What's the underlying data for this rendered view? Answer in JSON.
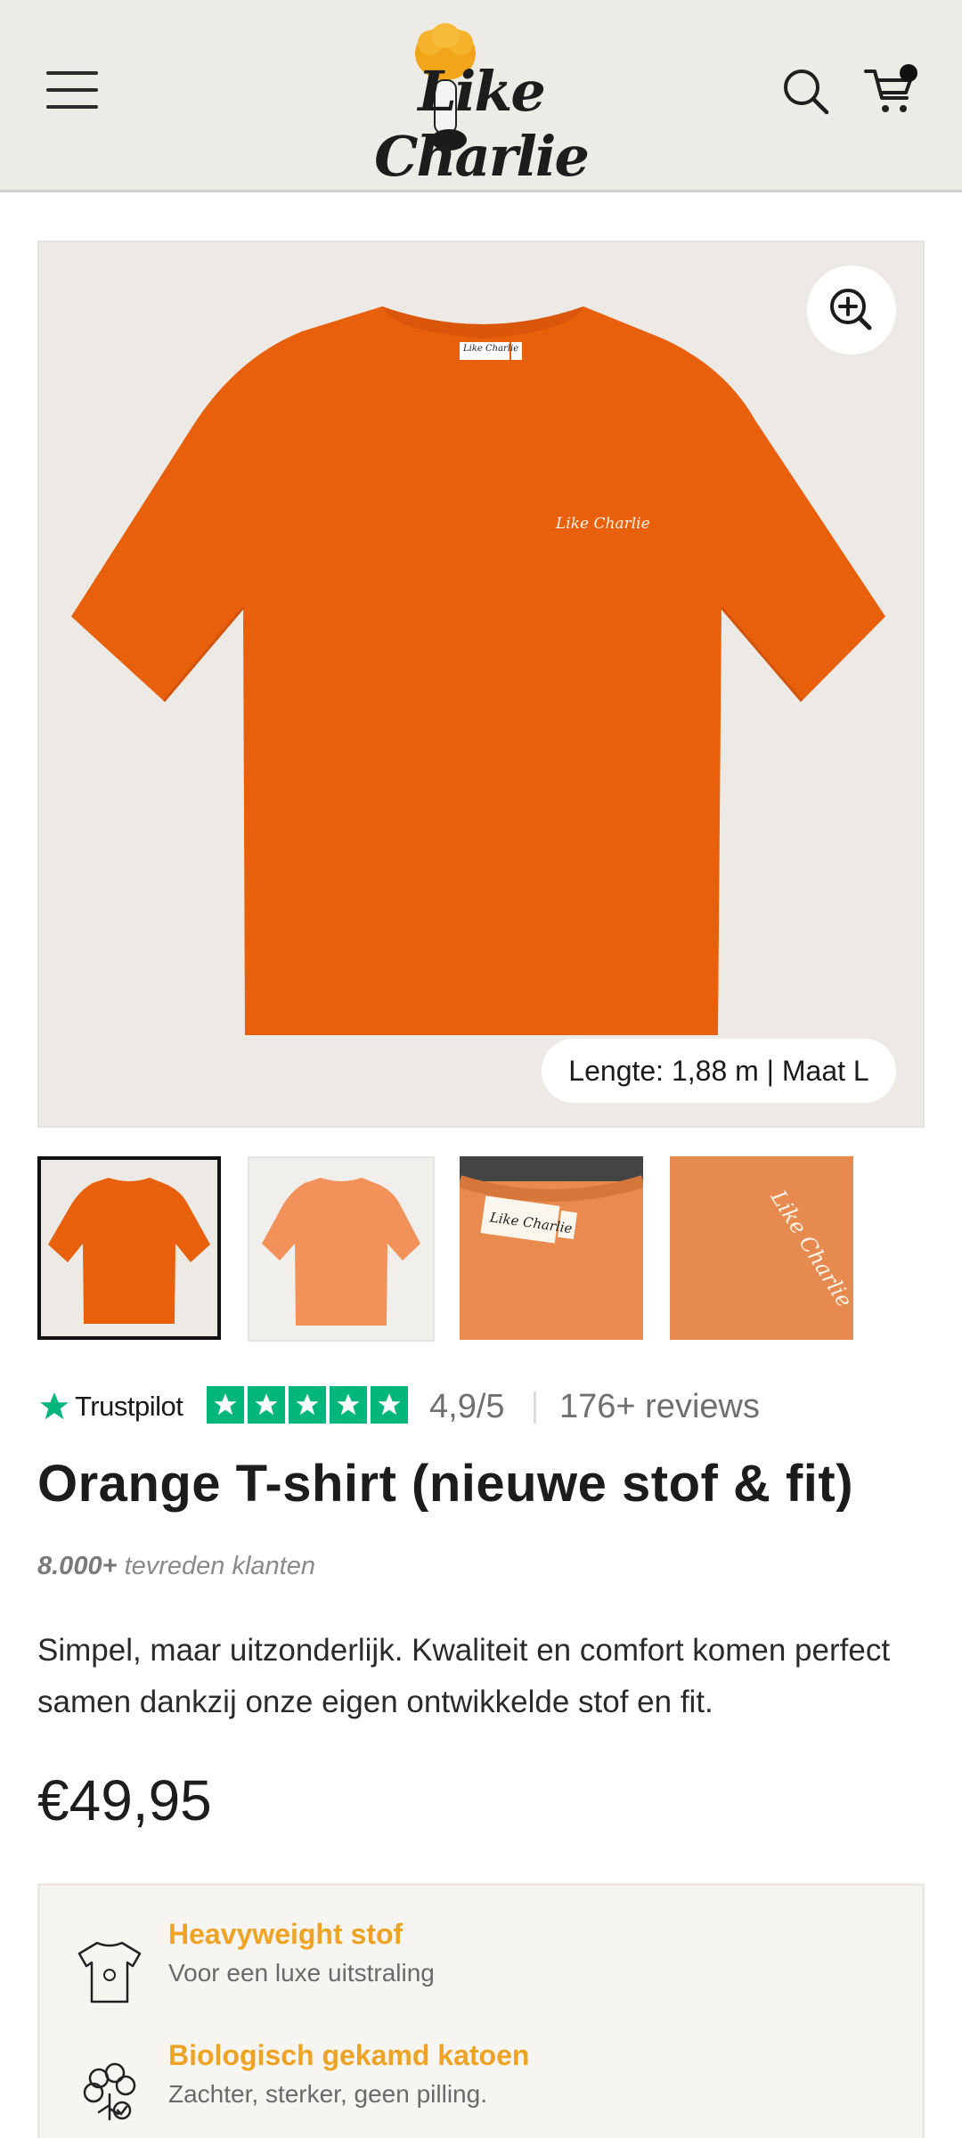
{
  "header": {
    "logo_text": "Like Charlie",
    "menu_icon": "hamburger-menu-icon",
    "search_icon": "search-icon",
    "cart_icon": "cart-icon"
  },
  "gallery": {
    "main_image_alt": "orange-tshirt-front",
    "zoom_icon": "zoom-in-icon",
    "caption": "Lengte: 1,88 m | Maat L",
    "shirt_chest_logo": "Like Charlie",
    "thumbnails": [
      {
        "name": "thumbnail-front",
        "active": true
      },
      {
        "name": "thumbnail-back",
        "active": false
      },
      {
        "name": "thumbnail-collar-label",
        "active": false
      },
      {
        "name": "thumbnail-embroidery",
        "active": false
      }
    ]
  },
  "rating": {
    "provider": "Trustpilot",
    "stars": 5,
    "score": "4,9/5",
    "reviews": "176+ reviews"
  },
  "product": {
    "title": "Orange T-shirt (nieuwe stof & fit)",
    "customers_bold": "8.000+",
    "customers_text": " tevreden klanten",
    "description": "Simpel, maar uitzonderlijk. Kwaliteit en comfort komen perfect samen dankzij onze eigen ontwikkelde stof en fit.",
    "price": "€49,95"
  },
  "features": [
    {
      "icon": "tshirt-icon",
      "title": "Heavyweight stof",
      "subtitle": "Voor een luxe uitstraling"
    },
    {
      "icon": "cotton-flower-icon",
      "title": "Biologisch gekamd katoen",
      "subtitle": "Zachter, sterker, geen pilling."
    }
  ],
  "colors": {
    "header_bg": "#ecebe6",
    "shirt_orange": "#e8600b",
    "trustpilot_green": "#00b67a",
    "feature_accent": "#efa324"
  }
}
